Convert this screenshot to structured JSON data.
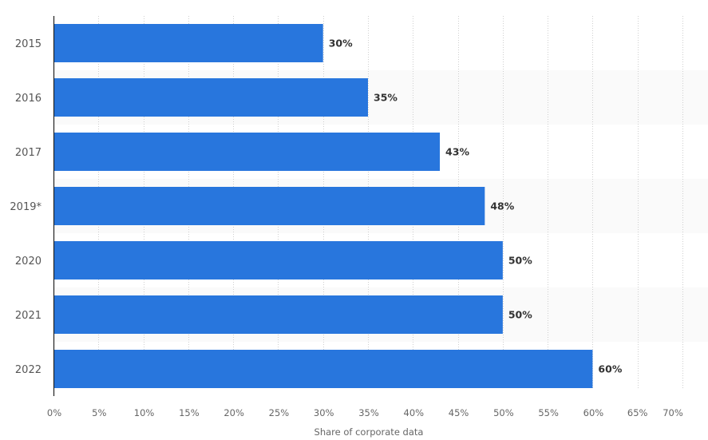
{
  "chart_data": {
    "type": "bar",
    "orientation": "horizontal",
    "title": "",
    "categories": [
      "2015",
      "2016",
      "2017",
      "2019*",
      "2020",
      "2021",
      "2022"
    ],
    "values": [
      30,
      35,
      43,
      48,
      50,
      50,
      60
    ],
    "data_labels": [
      "30%",
      "35%",
      "43%",
      "48%",
      "50%",
      "50%",
      "60%"
    ],
    "xlabel": "Share of corporate data",
    "ylabel": "",
    "xlim": [
      0,
      70
    ],
    "x_ticks": [
      0,
      5,
      10,
      15,
      20,
      25,
      30,
      35,
      40,
      45,
      50,
      55,
      60,
      65,
      70
    ],
    "x_tick_labels": [
      "0%",
      "5%",
      "10%",
      "15%",
      "20%",
      "25%",
      "30%",
      "35%",
      "40%",
      "45%",
      "50%",
      "55%",
      "60%",
      "65%",
      "70%"
    ],
    "grid": true,
    "legend": "none",
    "bar_color": "#2876dd",
    "band_color": "#fafafa"
  }
}
